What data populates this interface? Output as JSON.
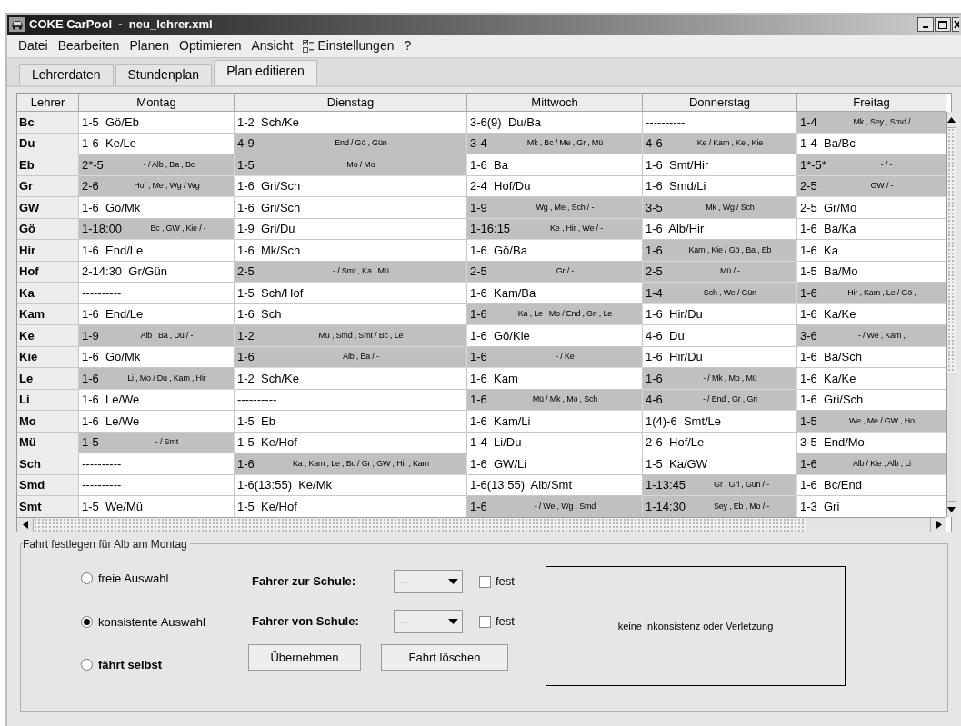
{
  "window": {
    "title": "COKE CarPool  -  neu_lehrer.xml"
  },
  "menu": [
    {
      "label": "Datei",
      "has_icon": false
    },
    {
      "label": "Bearbeiten",
      "has_icon": false
    },
    {
      "label": "Planen",
      "has_icon": false
    },
    {
      "label": "Optimieren",
      "has_icon": false
    },
    {
      "label": "Ansicht",
      "has_icon": false
    },
    {
      "label": "Einstellungen",
      "has_icon": true
    },
    {
      "label": "?",
      "has_icon": false
    }
  ],
  "tabs": [
    {
      "label": "Lehrerdaten",
      "selected": false
    },
    {
      "label": "Stundenplan",
      "selected": false
    },
    {
      "label": "Plan editieren",
      "selected": true
    }
  ],
  "table": {
    "columns": [
      "Lehrer",
      "Montag",
      "Dienstag",
      "Mittwoch",
      "Donnerstag",
      "Freitag"
    ],
    "rows": [
      {
        "teacher": "Bc",
        "cells": [
          {
            "kind": "plain",
            "text": "1-5  Gö/Eb"
          },
          {
            "kind": "plain",
            "text": "1-2  Sch/Ke"
          },
          {
            "kind": "plain",
            "text": "3-6(9)  Du/Ba"
          },
          {
            "kind": "plain",
            "text": "----------"
          },
          {
            "kind": "shaded",
            "time": "1-4",
            "drivers": "Mk , Sey , Smd /"
          }
        ]
      },
      {
        "teacher": "Du",
        "cells": [
          {
            "kind": "plain",
            "text": "1-6  Ke/Le"
          },
          {
            "kind": "shaded",
            "time": "4-9",
            "drivers": "End / Gö , Gün"
          },
          {
            "kind": "shaded",
            "time": "3-4",
            "drivers": "Mk , Bc / Me , Gr , Mü"
          },
          {
            "kind": "shaded",
            "time": "4-6",
            "drivers": "Ke / Kam , Ke , Kie"
          },
          {
            "kind": "plain",
            "text": "1-4  Ba/Bc"
          }
        ]
      },
      {
        "teacher": "Eb",
        "cells": [
          {
            "kind": "shaded",
            "time": "2*-5",
            "drivers": "- / Alb , Ba , Bc"
          },
          {
            "kind": "shaded",
            "time": "1-5",
            "drivers": "Mo / Mo"
          },
          {
            "kind": "plain",
            "text": "1-6  Ba"
          },
          {
            "kind": "plain",
            "text": "1-6  Smt/Hir"
          },
          {
            "kind": "shaded",
            "time": "1*-5*",
            "drivers": "- / -"
          }
        ]
      },
      {
        "teacher": "Gr",
        "cells": [
          {
            "kind": "shaded",
            "time": "2-6",
            "drivers": "Hof , Me , Wg / Wg"
          },
          {
            "kind": "plain",
            "text": "1-6  Gri/Sch"
          },
          {
            "kind": "plain",
            "text": "2-4  Hof/Du"
          },
          {
            "kind": "plain",
            "text": "1-6  Smd/Li"
          },
          {
            "kind": "shaded",
            "time": "2-5",
            "drivers": "GW / -"
          }
        ]
      },
      {
        "teacher": "GW",
        "cells": [
          {
            "kind": "plain",
            "text": "1-6  Gö/Mk"
          },
          {
            "kind": "plain",
            "text": "1-6  Gri/Sch"
          },
          {
            "kind": "shaded",
            "time": "1-9",
            "drivers": "Wg , Me , Sch / -"
          },
          {
            "kind": "shaded",
            "time": "3-5",
            "drivers": "Mk , Wg / Sch"
          },
          {
            "kind": "plain",
            "text": "2-5  Gr/Mo"
          }
        ]
      },
      {
        "teacher": "Gö",
        "cells": [
          {
            "kind": "shaded",
            "time": "1-18:00",
            "drivers": "Bc , GW , Kie / -"
          },
          {
            "kind": "plain",
            "text": "1-9  Gri/Du"
          },
          {
            "kind": "shaded",
            "time": "1-16:15",
            "drivers": "Ke , Hir , We / -"
          },
          {
            "kind": "plain",
            "text": "1-6  Alb/Hir"
          },
          {
            "kind": "plain",
            "text": "1-6  Ba/Ka"
          }
        ]
      },
      {
        "teacher": "Hir",
        "cells": [
          {
            "kind": "plain",
            "text": "1-6  End/Le"
          },
          {
            "kind": "plain",
            "text": "1-6  Mk/Sch"
          },
          {
            "kind": "plain",
            "text": "1-6  Gö/Ba"
          },
          {
            "kind": "shaded",
            "time": "1-6",
            "drivers": "Kam , Kie / Gö , Ba , Eb"
          },
          {
            "kind": "plain",
            "text": "1-6  Ka"
          }
        ]
      },
      {
        "teacher": "Hof",
        "cells": [
          {
            "kind": "plain",
            "text": "2-14:30  Gr/Gün"
          },
          {
            "kind": "shaded",
            "time": "2-5",
            "drivers": "- / Smt , Ka , Mü"
          },
          {
            "kind": "shaded",
            "time": "2-5",
            "drivers": "Gr / -"
          },
          {
            "kind": "shaded",
            "time": "2-5",
            "drivers": "Mü / -"
          },
          {
            "kind": "plain",
            "text": "1-5  Ba/Mo"
          }
        ]
      },
      {
        "teacher": "Ka",
        "cells": [
          {
            "kind": "plain",
            "text": "----------"
          },
          {
            "kind": "plain",
            "text": "1-5  Sch/Hof"
          },
          {
            "kind": "plain",
            "text": "1-6  Kam/Ba"
          },
          {
            "kind": "shaded",
            "time": "1-4",
            "drivers": "Sch , We / Gün"
          },
          {
            "kind": "shaded",
            "time": "1-6",
            "drivers": "Hir , Kam , Le / Gö ,"
          }
        ]
      },
      {
        "teacher": "Kam",
        "cells": [
          {
            "kind": "plain",
            "text": "1-6  End/Le"
          },
          {
            "kind": "plain",
            "text": "1-6  Sch"
          },
          {
            "kind": "shaded",
            "time": "1-6",
            "drivers": "Ka , Le , Mo / End , Gri , Le"
          },
          {
            "kind": "plain",
            "text": "1-6  Hir/Du"
          },
          {
            "kind": "plain",
            "text": "1-6  Ka/Ke"
          }
        ]
      },
      {
        "teacher": "Ke",
        "cells": [
          {
            "kind": "shaded",
            "time": "1-9",
            "drivers": "Alb , Ba , Du / -"
          },
          {
            "kind": "shaded",
            "time": "1-2",
            "drivers": "Mü , Smd , Smt / Bc , Le"
          },
          {
            "kind": "plain",
            "text": "1-6  Gö/Kie"
          },
          {
            "kind": "plain",
            "text": "4-6  Du"
          },
          {
            "kind": "shaded",
            "time": "3-6",
            "drivers": "- / We , Kam ,"
          }
        ]
      },
      {
        "teacher": "Kie",
        "cells": [
          {
            "kind": "plain",
            "text": "1-6  Gö/Mk"
          },
          {
            "kind": "shaded",
            "time": "1-6",
            "drivers": "Alb , Ba / -"
          },
          {
            "kind": "shaded",
            "time": "1-6",
            "drivers": "- / Ke"
          },
          {
            "kind": "plain",
            "text": "1-6  Hir/Du"
          },
          {
            "kind": "plain",
            "text": "1-6  Ba/Sch"
          }
        ]
      },
      {
        "teacher": "Le",
        "cells": [
          {
            "kind": "shaded",
            "time": "1-6",
            "drivers": "Li , Mo / Du , Kam , Hir"
          },
          {
            "kind": "plain",
            "text": "1-2  Sch/Ke"
          },
          {
            "kind": "plain",
            "text": "1-6  Kam"
          },
          {
            "kind": "shaded",
            "time": "1-6",
            "drivers": "- / Mk , Mo , Mü"
          },
          {
            "kind": "plain",
            "text": "1-6  Ka/Ke"
          }
        ]
      },
      {
        "teacher": "Li",
        "cells": [
          {
            "kind": "plain",
            "text": "1-6  Le/We"
          },
          {
            "kind": "plain",
            "text": "----------"
          },
          {
            "kind": "shaded",
            "time": "1-6",
            "drivers": "Mü / Mk , Mo , Sch"
          },
          {
            "kind": "shaded",
            "time": "4-6",
            "drivers": "- / End , Gr , Gri"
          },
          {
            "kind": "plain",
            "text": "1-6  Gri/Sch"
          }
        ]
      },
      {
        "teacher": "Mo",
        "cells": [
          {
            "kind": "plain",
            "text": "1-6  Le/We"
          },
          {
            "kind": "plain",
            "text": "1-5  Eb"
          },
          {
            "kind": "plain",
            "text": "1-6  Kam/Li"
          },
          {
            "kind": "plain",
            "text": "1(4)-6  Smt/Le"
          },
          {
            "kind": "shaded",
            "time": "1-5",
            "drivers": "We , Me / GW , Ho"
          }
        ]
      },
      {
        "teacher": "Mü",
        "cells": [
          {
            "kind": "shaded",
            "time": "1-5",
            "drivers": "- / Smt"
          },
          {
            "kind": "plain",
            "text": "1-5  Ke/Hof"
          },
          {
            "kind": "plain",
            "text": "1-4  Li/Du"
          },
          {
            "kind": "plain",
            "text": "2-6  Hof/Le"
          },
          {
            "kind": "plain",
            "text": "3-5  End/Mo"
          }
        ]
      },
      {
        "teacher": "Sch",
        "cells": [
          {
            "kind": "plain",
            "text": "----------"
          },
          {
            "kind": "shaded",
            "time": "1-6",
            "drivers": "Ka , Kam , Le , Bc / Gr , GW , Hir , Kam"
          },
          {
            "kind": "plain",
            "text": "1-6  GW/Li"
          },
          {
            "kind": "plain",
            "text": "1-5  Ka/GW"
          },
          {
            "kind": "shaded",
            "time": "1-6",
            "drivers": "Alb / Kie , Alb , Li"
          }
        ]
      },
      {
        "teacher": "Smd",
        "cells": [
          {
            "kind": "plain",
            "text": "----------"
          },
          {
            "kind": "plain",
            "text": "1-6(13:55)  Ke/Mk"
          },
          {
            "kind": "plain",
            "text": "1-6(13:55)  Alb/Smt"
          },
          {
            "kind": "shaded",
            "time": "1-13:45",
            "drivers": "Gr , Gri , Gün / -"
          },
          {
            "kind": "plain",
            "text": "1-6  Bc/End"
          }
        ]
      },
      {
        "teacher": "Smt",
        "cells": [
          {
            "kind": "plain",
            "text": "1-5  We/Mü"
          },
          {
            "kind": "plain",
            "text": "1-5  Ke/Hof"
          },
          {
            "kind": "shaded",
            "time": "1-6",
            "drivers": "- / We , Wg , Smd"
          },
          {
            "kind": "shaded",
            "time": "1-14:30",
            "drivers": "Sey , Eb , Mo / -"
          },
          {
            "kind": "plain",
            "text": "1-3  Gri"
          }
        ]
      }
    ]
  },
  "trip_panel": {
    "title": "Fahrt festlegen für Alb am Montag",
    "modes": [
      {
        "label": "freie Auswahl",
        "selected": false,
        "bold": false
      },
      {
        "label": "konsistente Auswahl",
        "selected": true,
        "bold": false
      },
      {
        "label": "fährt selbst",
        "selected": false,
        "bold": true
      }
    ],
    "drivers": [
      {
        "label": "Fahrer zur Schule:",
        "value": "---",
        "fixed_label": "fest",
        "checked": false
      },
      {
        "label": "Fahrer von Schule:",
        "value": "---",
        "fixed_label": "fest",
        "checked": false
      }
    ],
    "buttons": [
      "Übernehmen",
      "Fahrt löschen"
    ],
    "message": "keine Inkonsistenz oder Verletzung"
  }
}
